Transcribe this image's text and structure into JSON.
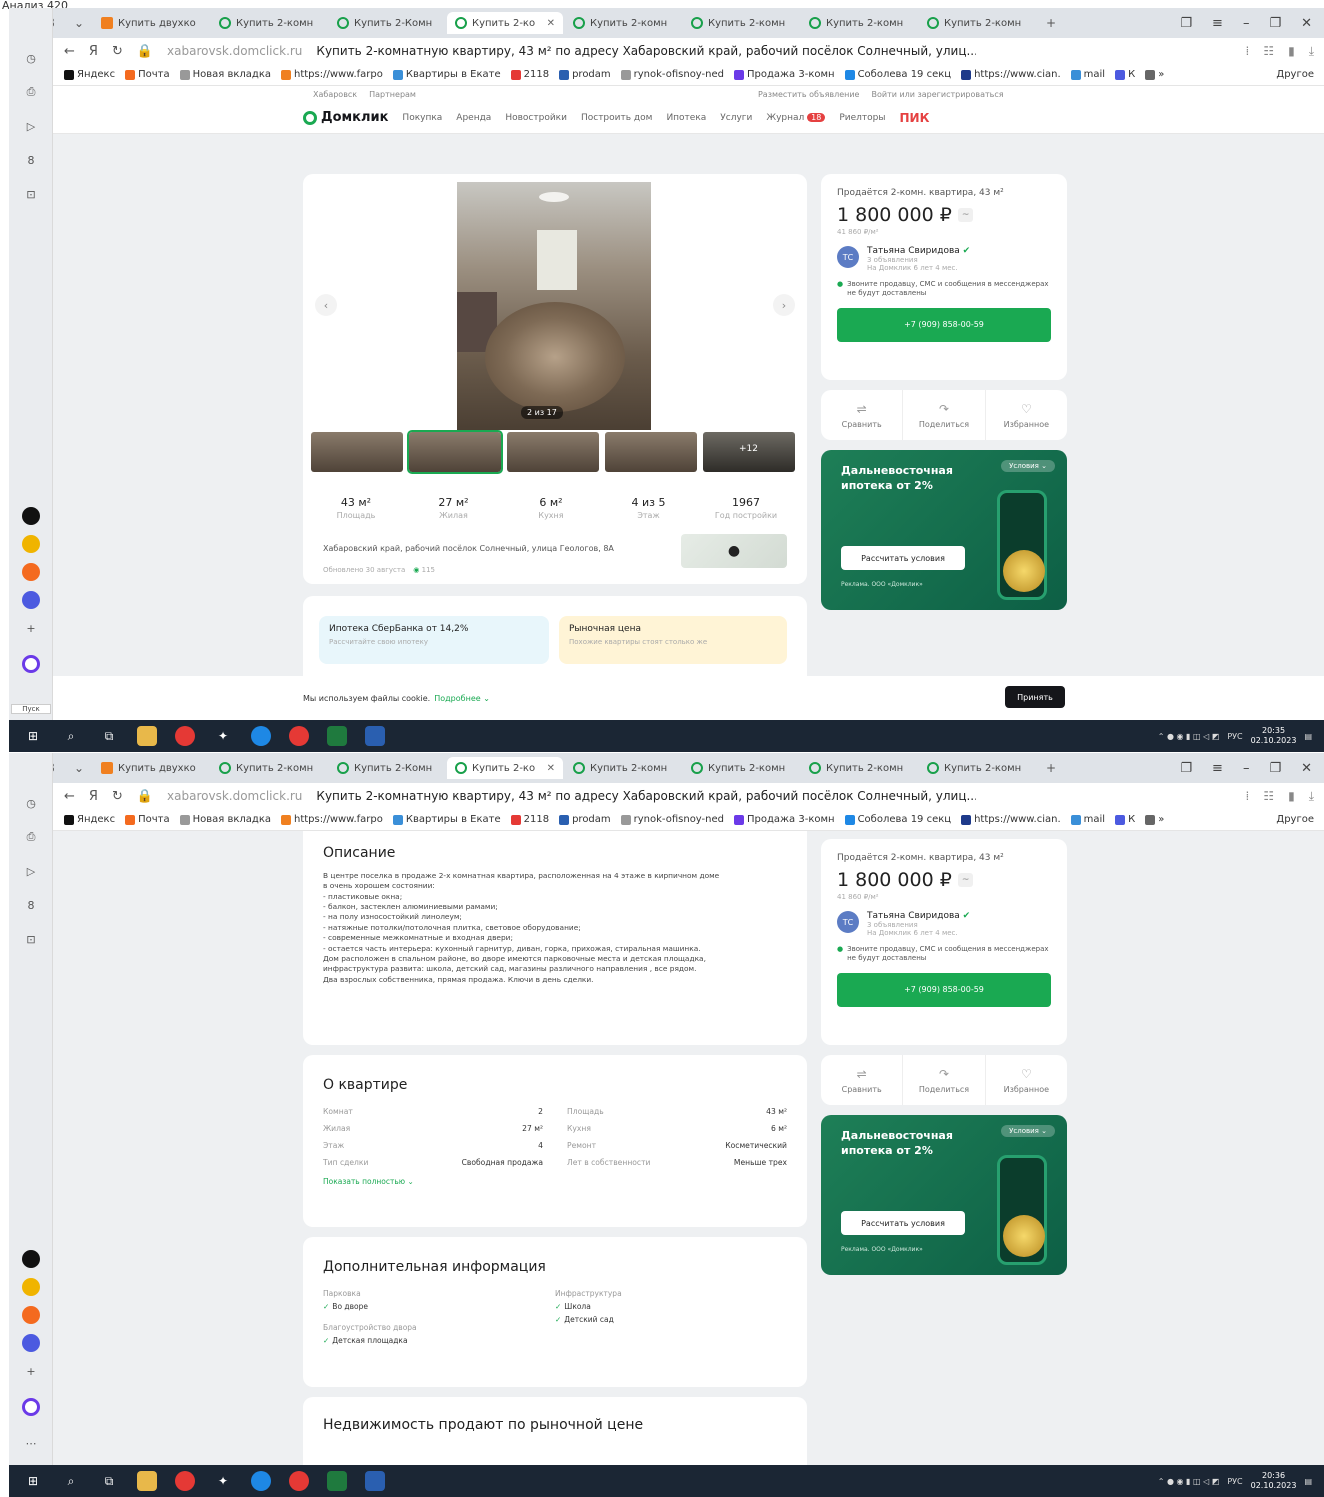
{
  "caption": "Анализ 420",
  "tabs": [
    {
      "label": "Купить двухко",
      "fav": "orange"
    },
    {
      "label": "Купить 2-комн",
      "fav": "green"
    },
    {
      "label": "Купить 2-Комн",
      "fav": "green"
    },
    {
      "label": "Купить 2-ко",
      "fav": "green",
      "active": true
    },
    {
      "label": "Купить 2-комн",
      "fav": "green"
    },
    {
      "label": "Купить 2-комн",
      "fav": "green"
    },
    {
      "label": "Купить 2-комн",
      "fav": "green"
    },
    {
      "label": "Купить 2-комн",
      "fav": "green"
    }
  ],
  "address_bar": {
    "url": "xabarovsk.domclick.ru",
    "page_title": "Купить 2-комнатную квартиру, 43 м² по адресу Хабаровский край, рабочий посёлок Солнечный, улиц..."
  },
  "bookmarks": [
    "Яндекс",
    "Почта",
    "Новая вкладка",
    "https://www.farpo",
    "Квартиры в Екате",
    "2118",
    "prodam",
    "rynok-ofisnoy-ned",
    "Продажа 3-комн",
    "Соболева 19 секц",
    "https://www.cian.",
    "mail",
    "К",
    "»"
  ],
  "bookmarks_other": "Другое",
  "site": {
    "subheader": [
      "Хабаровск",
      "Партнерам",
      "Разместить объявление",
      "Войти или зарегистрироваться"
    ],
    "logo": "Домклик",
    "nav": [
      "Покупка",
      "Аренда",
      "Новостройки",
      "Построить дом",
      "Ипотека",
      "Услуги",
      "Журнал",
      "Риелторы"
    ],
    "journal_badge": "18",
    "pik": "ПИК"
  },
  "listing": {
    "photo_counter": "2 из 17",
    "thumb_more": "+12",
    "stats": [
      {
        "value": "43 м²",
        "label": "Площадь"
      },
      {
        "value": "27 м²",
        "label": "Жилая"
      },
      {
        "value": "6 м²",
        "label": "Кухня"
      },
      {
        "value": "4 из 5",
        "label": "Этаж"
      },
      {
        "value": "1967",
        "label": "Год постройки"
      }
    ],
    "address": "Хабаровский край, рабочий посёлок Солнечный, улица Геологов, 8А",
    "updated": "Обновлено 30 августа",
    "views": "115"
  },
  "promos": [
    {
      "title": "Ипотека СберБанка от 14,2%",
      "sub": "Рассчитайте свою ипотеку"
    },
    {
      "title": "Рыночная цена",
      "sub": "Похожие квартиры стоят столько же"
    }
  ],
  "sidebar_card": {
    "title": "Продаётся 2-комн. квартира, 43 м²",
    "price": "1 800 000 ₽",
    "price_per_m": "41 860 ₽/м²",
    "agent_initials": "ТС",
    "agent_name": "Татьяна Свиридова",
    "agent_ads": "3 объявления",
    "agent_since": "На Домклик 6 лет 4 мес.",
    "notice": "Звоните продавцу, СМС и сообщения в мессенджерах не будут доставлены",
    "phone": "+7 (909) 858-00-59"
  },
  "actions": [
    "Сравнить",
    "Поделиться",
    "Избранное"
  ],
  "banner": {
    "conditions": "Условия",
    "title": "Дальневосточная ипотека от 2%",
    "button": "Рассчитать условия",
    "ad": "Реклама. ООО «Домклик»"
  },
  "cookie": {
    "text": "Мы используем файлы cookie.",
    "more": "Подробнее",
    "accept": "Принять"
  },
  "description": {
    "title": "Описание",
    "text": "В центре поселка в продаже 2-х комнатная квартира, расположенная на 4 этаже в кирпичном доме\nв очень хорошем состоянии:\n- пластиковые окна;\n- балкон, застеклен алюминиевыми рамами;\n- на полу износостойкий линолеум;\n- натяжные потолки/потолочная плитка, световое оборудование;\n- современные межкомнатные и входная двери;\n- остается часть интерьера: кухонный гарнитур, диван, горка, прихожая, стиральная машинка.\nДом расположен в спальном районе, во дворе имеются парковочные места и детская площадка,\nинфраструктура развита: школа, детский сад, магазины различного направления , все рядом.\nДва взрослых собственника, прямая продажа. Ключи в день сделки."
  },
  "about": {
    "title": "О квартире",
    "rows": [
      {
        "k": "Комнат",
        "v": "2"
      },
      {
        "k": "Площадь",
        "v": "43 м²"
      },
      {
        "k": "Жилая",
        "v": "27 м²"
      },
      {
        "k": "Кухня",
        "v": "6 м²"
      },
      {
        "k": "Этаж",
        "v": "4"
      },
      {
        "k": "Ремонт",
        "v": "Косметический"
      },
      {
        "k": "Тип сделки",
        "v": "Свободная продажа"
      },
      {
        "k": "Лет в собственности",
        "v": "Меньше трех"
      }
    ],
    "show_full": "Показать полностью"
  },
  "additional": {
    "title": "Дополнительная информация",
    "groups": [
      {
        "k": "Парковка",
        "items": [
          "Во дворе"
        ]
      },
      {
        "k": "Инфраструктура",
        "items": [
          "Школа",
          "Детский сад"
        ]
      },
      {
        "k": "Благоустройство двора",
        "items": [
          "Детская площадка"
        ]
      }
    ]
  },
  "market": {
    "title": "Недвижимость продают по рыночной цене"
  },
  "tray": {
    "lang": "РУС",
    "date": "02.10.2023",
    "time1": "20:35",
    "time2": "20:36"
  },
  "pusk": "Пуск"
}
